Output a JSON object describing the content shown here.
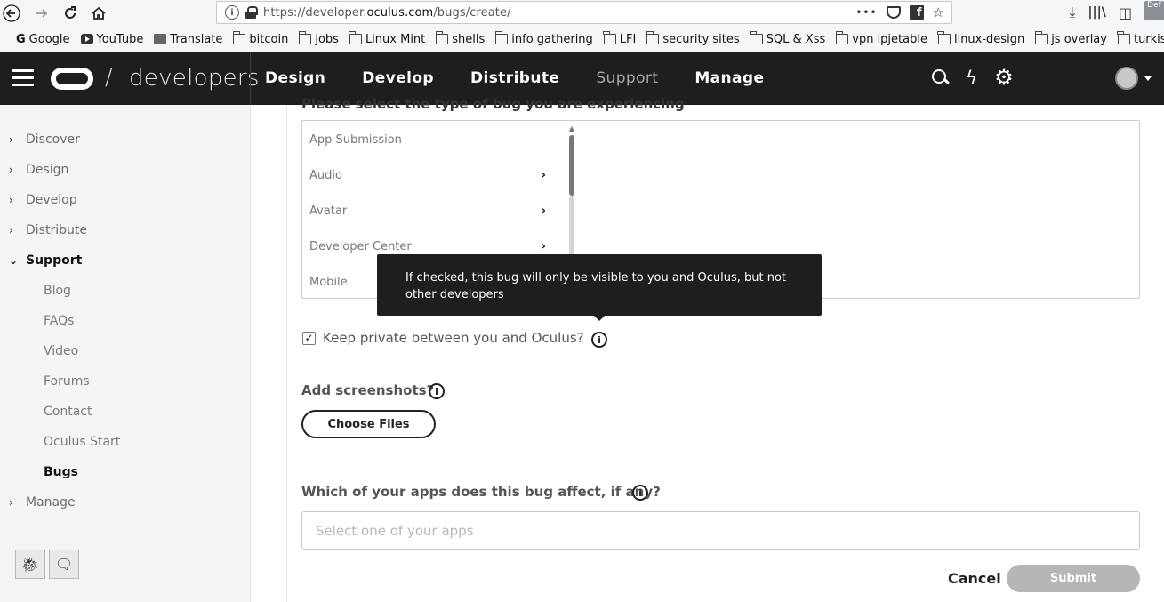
{
  "browser": {
    "url_prefix": "https://developer.",
    "url_domain": "oculus.com",
    "url_path": "/bugs/create/",
    "more_label": "•••",
    "def_badge": "Def",
    "bookmarks": [
      {
        "label": "Google",
        "icon": "google-icon"
      },
      {
        "label": "YouTube",
        "icon": "youtube-icon"
      },
      {
        "label": "Translate",
        "icon": "translate-icon"
      },
      {
        "label": "bitcoin",
        "icon": "folder-icon"
      },
      {
        "label": "jobs",
        "icon": "folder-icon"
      },
      {
        "label": "Linux Mint",
        "icon": "folder-icon"
      },
      {
        "label": "shells",
        "icon": "folder-icon"
      },
      {
        "label": "info gathering",
        "icon": "folder-icon"
      },
      {
        "label": "LFI",
        "icon": "folder-icon"
      },
      {
        "label": "security sites",
        "icon": "folder-icon"
      },
      {
        "label": "SQL & Xss",
        "icon": "folder-icon"
      },
      {
        "label": "vpn ipjetable",
        "icon": "folder-icon"
      },
      {
        "label": "linux-design",
        "icon": "folder-icon"
      },
      {
        "label": "js overlay",
        "icon": "folder-icon"
      },
      {
        "label": "turkish",
        "icon": "folder-icon"
      }
    ]
  },
  "header": {
    "brand": "developers",
    "slash": "/",
    "nav": [
      {
        "label": "Design"
      },
      {
        "label": "Develop"
      },
      {
        "label": "Distribute"
      },
      {
        "label": "Support"
      },
      {
        "label": "Manage"
      }
    ]
  },
  "sidebar": {
    "items": [
      {
        "label": "Discover"
      },
      {
        "label": "Design"
      },
      {
        "label": "Develop"
      },
      {
        "label": "Distribute"
      },
      {
        "label": "Support"
      }
    ],
    "sub_items": [
      {
        "label": "Blog"
      },
      {
        "label": "FAQs"
      },
      {
        "label": "Video"
      },
      {
        "label": "Forums"
      },
      {
        "label": "Contact"
      },
      {
        "label": "Oculus Start"
      },
      {
        "label": "Bugs"
      }
    ],
    "manage": "Manage"
  },
  "form": {
    "bug_type_label": "Please select the type of bug you are experiencing",
    "bug_types": [
      {
        "label": "App Submission",
        "has_children": false
      },
      {
        "label": "Audio",
        "has_children": true
      },
      {
        "label": "Avatar",
        "has_children": true
      },
      {
        "label": "Developer Center",
        "has_children": true
      },
      {
        "label": "Mobile",
        "has_children": false
      }
    ],
    "tooltip": "If checked, this bug will only be visible to you and Oculus, but not other developers",
    "private_label": "Keep private between you and Oculus?",
    "private_checked": true,
    "screenshots_label": "Add screenshots?",
    "choose_files": "Choose Files",
    "apps_label": "Which of your apps does this bug affect, if any?",
    "apps_placeholder": "Select one of your apps",
    "cancel": "Cancel",
    "submit": "Submit"
  }
}
